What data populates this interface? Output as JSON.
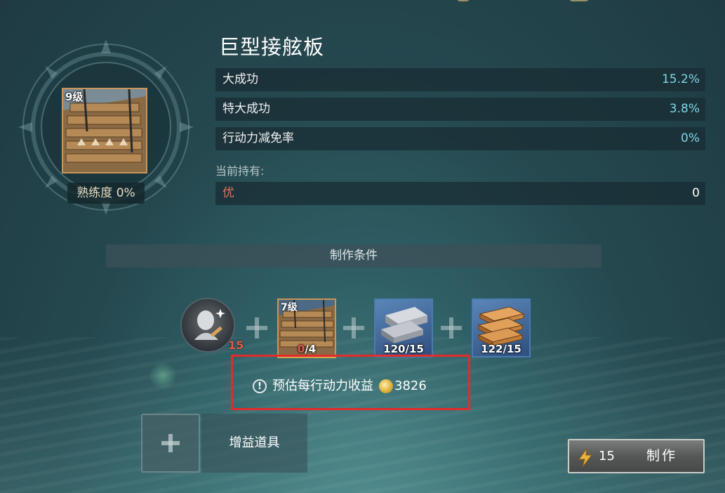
{
  "item": {
    "name": "巨型接舷板",
    "level_badge": "9级",
    "proficiency": "熟练度 0%"
  },
  "stats": [
    {
      "label": "大成功",
      "value": "15.2%"
    },
    {
      "label": "特大成功",
      "value": "3.8%"
    },
    {
      "label": "行动力减免率",
      "value": "0%"
    }
  ],
  "holding": {
    "label": "当前持有:",
    "grade": "优",
    "count": "0"
  },
  "conditions": {
    "title": "制作条件",
    "character": {
      "icon": "statue-artisan-icon",
      "value": "15"
    },
    "materials": [
      {
        "icon": "boarding-plank-icon",
        "level": "7级",
        "have": "0",
        "need": "/4",
        "display": "0/4"
      },
      {
        "icon": "iron-ingots-icon",
        "display": "120/15"
      },
      {
        "icon": "lumber-planks-icon",
        "display": "122/15"
      }
    ]
  },
  "estimate": {
    "text": "预估每行动力收益",
    "value": "3826"
  },
  "buff": {
    "label": "增益道具"
  },
  "craft": {
    "cost": "15",
    "label": "制作"
  }
}
